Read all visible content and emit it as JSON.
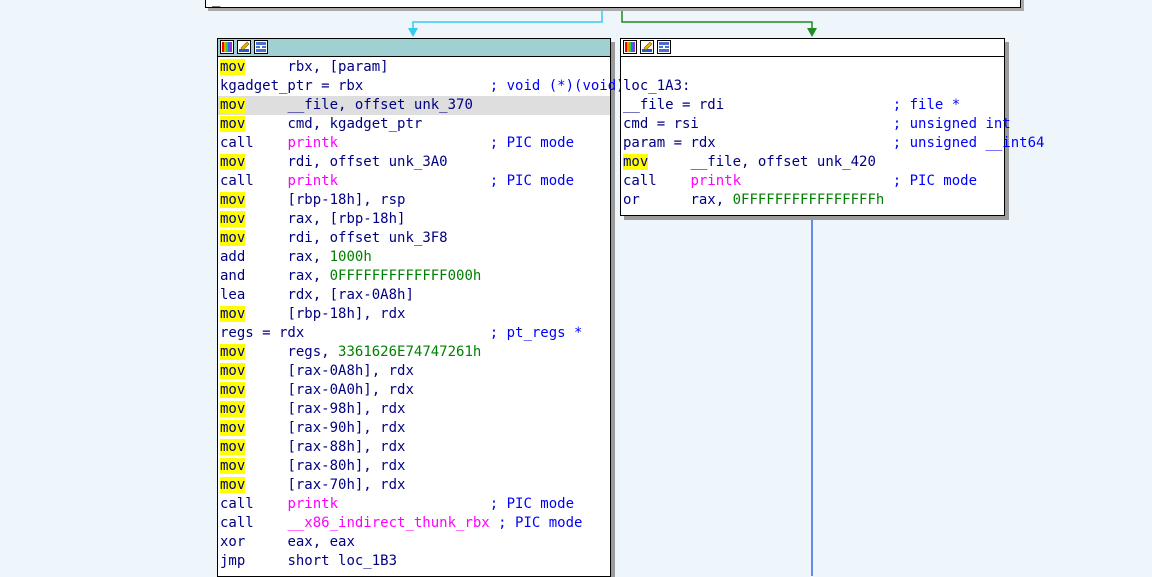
{
  "colors": {
    "background": "#eef6fc",
    "header_selected": "#9fd0d2",
    "mnemonic_highlight": "#ffff00",
    "text_default": "#000080",
    "text_function": "#ff00ff",
    "text_number": "#008000",
    "text_comment": "#0000ff",
    "edge_cyan": "#33ccee",
    "edge_green": "#1e8c1e",
    "edge_blue": "#3c64e6"
  },
  "top_node": {
    "fragment": "_"
  },
  "header_icons": [
    "color-palette-icon",
    "rename-pencil-icon",
    "graph-overview-icon"
  ],
  "left_block": {
    "lines": [
      {
        "m": "mov",
        "a": "rbx, [param]",
        "hl_mn": true
      },
      {
        "m": "kgadget_ptr = rbx",
        "a": "; void (*)(void)",
        "plain": true,
        "cmt": true
      },
      {
        "m": "mov",
        "a": "__file, offset unk_370",
        "hl_mn": true,
        "hl_line": true
      },
      {
        "m": "mov",
        "a": "cmd, kgadget_ptr",
        "hl_mn": true
      },
      {
        "m": "call",
        "a": "printk",
        "fn": true,
        "c": "; PIC mode"
      },
      {
        "m": "mov",
        "a": "rdi, offset unk_3A0",
        "hl_mn": true
      },
      {
        "m": "call",
        "a": "printk",
        "fn": true,
        "c": "; PIC mode"
      },
      {
        "m": "mov",
        "a": "[rbp-18h], rsp",
        "hl_mn": true
      },
      {
        "m": "mov",
        "a": "rax, [rbp-18h]",
        "hl_mn": true
      },
      {
        "m": "mov",
        "a": "rdi, offset unk_3F8",
        "hl_mn": true
      },
      {
        "m": "add",
        "a": "rax, ",
        "n": "1000h"
      },
      {
        "m": "and",
        "a": "rax, ",
        "n": "0FFFFFFFFFFFFF000h"
      },
      {
        "m": "lea",
        "a": "rdx, [rax-0A8h]"
      },
      {
        "m": "mov",
        "a": "[rbp-18h], rdx",
        "hl_mn": true
      },
      {
        "m": "regs = rdx",
        "a": "; pt_regs *",
        "plain": true,
        "cmt": true
      },
      {
        "m": "mov",
        "a": "regs, ",
        "n": "3361626E74747261h",
        "hl_mn": true
      },
      {
        "m": "mov",
        "a": "[rax-0A8h], rdx",
        "hl_mn": true
      },
      {
        "m": "mov",
        "a": "[rax-0A0h], rdx",
        "hl_mn": true
      },
      {
        "m": "mov",
        "a": "[rax-98h], rdx",
        "hl_mn": true
      },
      {
        "m": "mov",
        "a": "[rax-90h], rdx",
        "hl_mn": true
      },
      {
        "m": "mov",
        "a": "[rax-88h], rdx",
        "hl_mn": true
      },
      {
        "m": "mov",
        "a": "[rax-80h], rdx",
        "hl_mn": true
      },
      {
        "m": "mov",
        "a": "[rax-70h], rdx",
        "hl_mn": true
      },
      {
        "m": "call",
        "a": "printk",
        "fn": true,
        "c": "; PIC mode"
      },
      {
        "m": "call",
        "a": "__x86_indirect_thunk_rbx",
        "fn": true,
        "c": "; PIC mode",
        "tight": true
      },
      {
        "m": "xor",
        "a": "eax, eax"
      },
      {
        "m": "jmp",
        "a": "short loc_1B3"
      }
    ]
  },
  "right_block": {
    "label": "loc_1A3:",
    "lines": [
      {
        "m": "__file = rdi",
        "a": "; file *",
        "plain": true,
        "cmt": true
      },
      {
        "m": "cmd = rsi",
        "a": "; unsigned int",
        "plain": true,
        "cmt": true
      },
      {
        "m": "param = rdx",
        "a": "; unsigned __int64",
        "plain": true,
        "cmt": true
      },
      {
        "m": "mov",
        "a": "__file, offset unk_420",
        "hl_mn": true
      },
      {
        "m": "call",
        "a": "printk",
        "fn": true,
        "c": "; PIC mode"
      },
      {
        "m": "or",
        "a": "rax, ",
        "n": "0FFFFFFFFFFFFFFFFh"
      }
    ]
  }
}
